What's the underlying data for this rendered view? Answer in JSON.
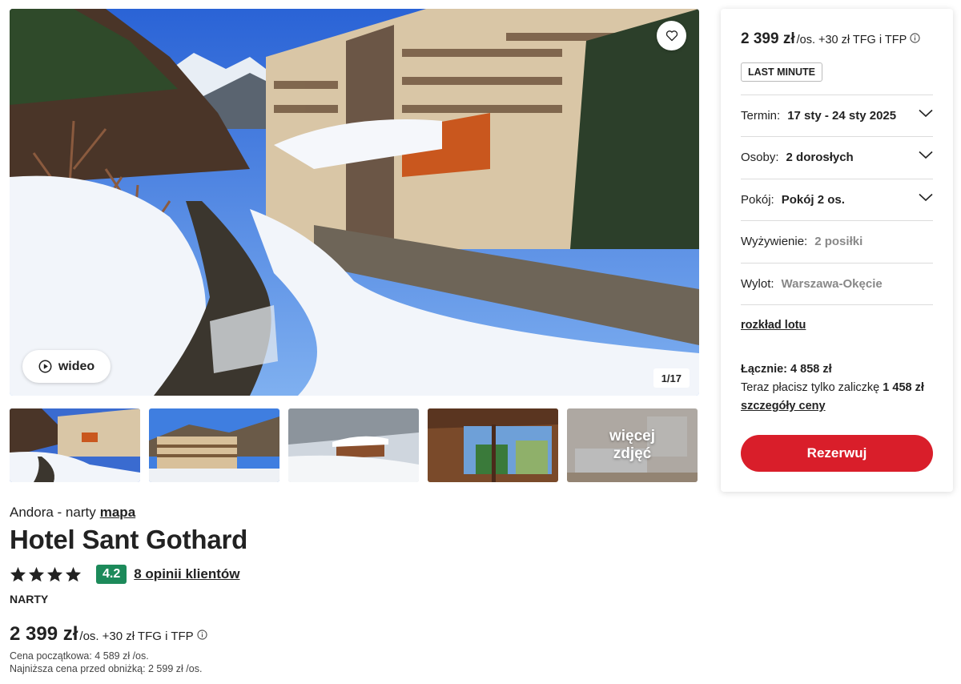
{
  "hero": {
    "video_label": "wideo",
    "counter": "1/17"
  },
  "thumbnails": {
    "more_label_line1": "więcej",
    "more_label_line2": "zdjęć"
  },
  "hotel": {
    "location": "Andora - narty",
    "map_link": "mapa",
    "name": "Hotel Sant Gothard",
    "stars": 4,
    "score": "4.2",
    "reviews": "8 opinii klientów",
    "category": "NARTY",
    "price": "2 399 zł",
    "per_person": "/os.",
    "fee": "+30 zł TFG i TFP",
    "original_price": "Cena początkowa: 4 589 zł /os.",
    "lowest_price": "Najniższa cena przed obniżką: 2 599 zł /os."
  },
  "panel": {
    "price": "2 399 zł",
    "per_person": "/os.",
    "fee": "+30 zł TFG i TFP",
    "badge": "LAST MINUTE",
    "rows": [
      {
        "label": "Termin:",
        "value": "17 sty - 24 sty 2025"
      },
      {
        "label": "Osoby:",
        "value": "2 dorosłych"
      },
      {
        "label": "Pokój:",
        "value": "Pokój 2 os."
      },
      {
        "label": "Wyżywienie:",
        "value": "2 posiłki"
      },
      {
        "label": "Wylot:",
        "value": "Warszawa-Okęcie"
      }
    ],
    "flight_link": "rozkład lotu",
    "total": "Łącznie: 4 858 zł",
    "deposit_text": "Teraz płacisz tylko zaliczkę",
    "deposit_amount": "1 458 zł",
    "details_link": "szczegóły ceny",
    "book_button": "Rezerwuj"
  },
  "colors": {
    "accent_red": "#d91e2a",
    "score_green": "#1c8a5a"
  }
}
